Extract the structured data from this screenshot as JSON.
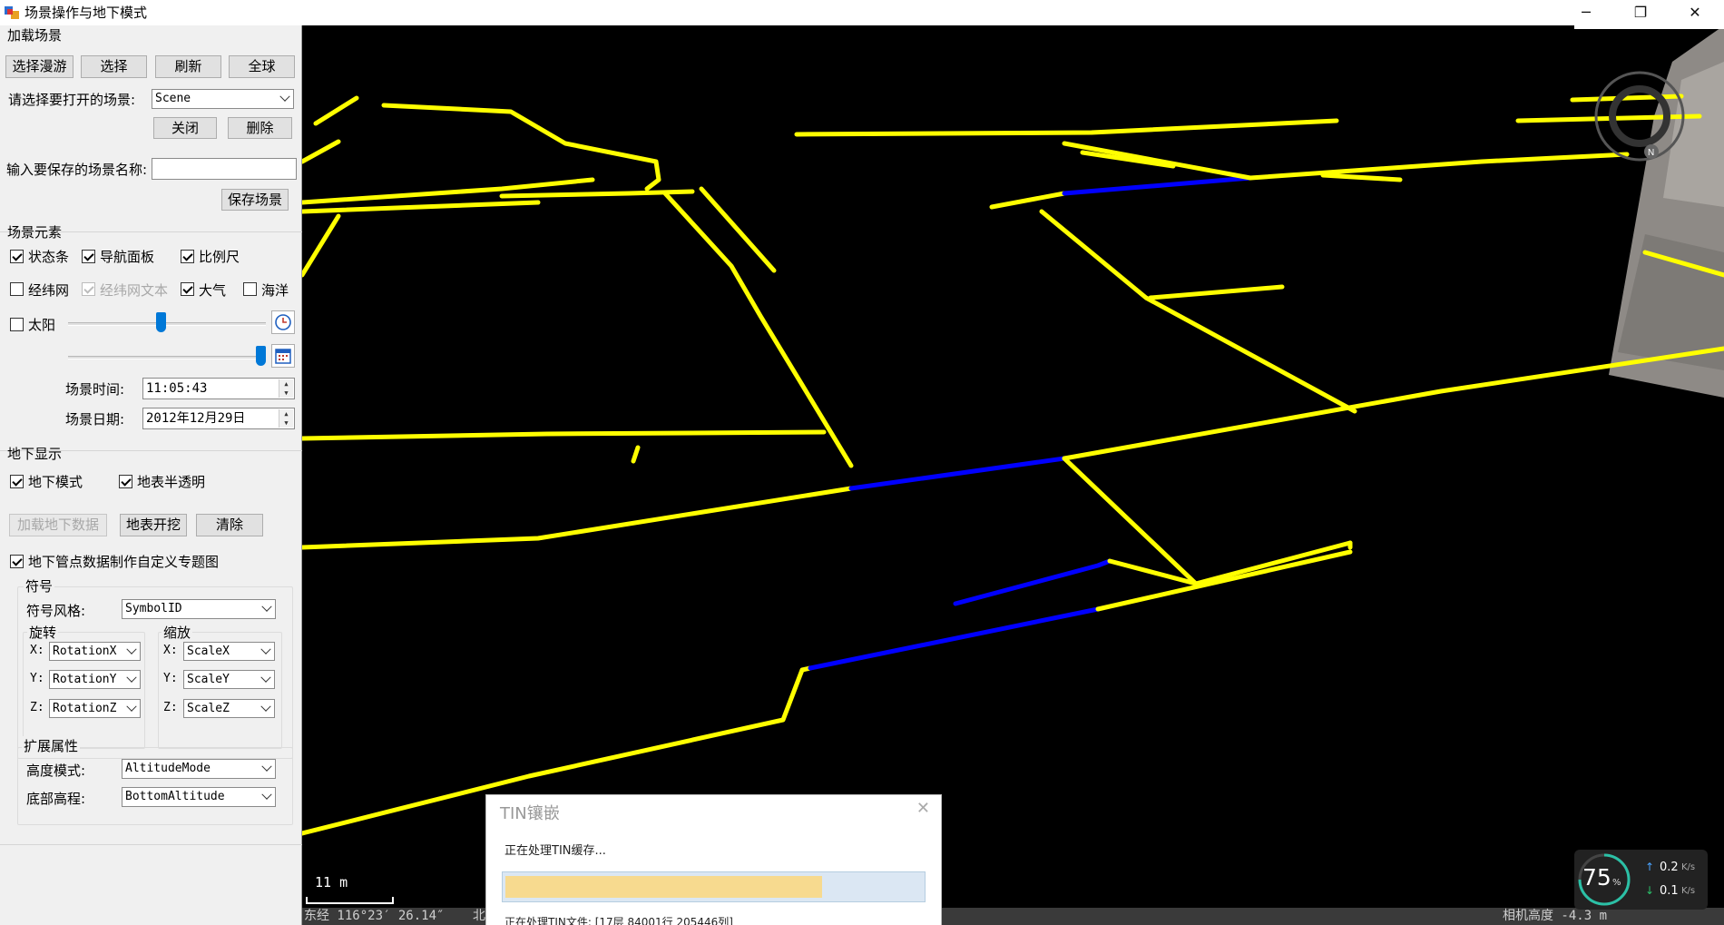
{
  "window": {
    "title": "场景操作与地下模式",
    "minimize_glyph": "─",
    "restore_glyph": "❐",
    "close_glyph": "✕"
  },
  "load_scene": {
    "group_label": "加载场景",
    "buttons": [
      "选择漫游",
      "选择",
      "刷新",
      "全球"
    ],
    "select_label": "请选择要打开的场景:",
    "scene_value": "Scene",
    "close_button": "关闭",
    "delete_button": "删除",
    "save_name_label": "输入要保存的场景名称:",
    "save_name_value": "",
    "save_button": "保存场景"
  },
  "scene_elements": {
    "group_label": "场景元素",
    "statusbar": {
      "label": "状态条",
      "checked": true
    },
    "navpanel": {
      "label": "导航面板",
      "checked": true
    },
    "scalebar": {
      "label": "比例尺",
      "checked": true
    },
    "graticule": {
      "label": "经纬网",
      "checked": false
    },
    "graticule_text": {
      "label": "经纬网文本",
      "checked": true,
      "enabled": false
    },
    "atmosphere": {
      "label": "大气",
      "checked": true
    },
    "ocean": {
      "label": "海洋",
      "checked": false
    },
    "sun": {
      "label": "太阳",
      "checked": false
    },
    "sun_slider_fraction": 0.47,
    "date_slider_fraction": 1.0,
    "time_label": "场景时间:",
    "time_value": "11:05:43",
    "date_label": "场景日期:",
    "date_value": "2012年12月29日",
    "clock_icon": "clock-icon",
    "calendar_icon": "calendar-icon"
  },
  "underground": {
    "group_label": "地下显示",
    "mode": {
      "label": "地下模式",
      "checked": true
    },
    "translucent": {
      "label": "地表半透明",
      "checked": true
    },
    "load_button": "加载地下数据",
    "excavate_button": "地表开挖",
    "clear_button": "清除",
    "custom_theme": {
      "label": "地下管点数据制作自定义专题图",
      "checked": true
    }
  },
  "symbol": {
    "group_label": "符号",
    "style_label": "符号风格:",
    "style_value": "SymbolID",
    "rotation_label": "旋转",
    "scale_label": "缩放",
    "rot_x_label": "X:",
    "rot_x_value": "RotationX",
    "rot_y_label": "Y:",
    "rot_y_value": "RotationY",
    "rot_z_label": "Z:",
    "rot_z_value": "RotationZ",
    "scale_x_label": "X:",
    "scale_x_value": "ScaleX",
    "scale_y_label": "Y:",
    "scale_y_value": "ScaleY",
    "scale_z_label": "Z:",
    "scale_z_value": "ScaleZ"
  },
  "extended": {
    "group_label": "扩展属性",
    "altitude_mode_label": "高度模式:",
    "altitude_mode_value": "AltitudeMode",
    "bottom_alt_label": "底部高程:",
    "bottom_alt_value": "BottomAltitude"
  },
  "viewport": {
    "scale_text": "11 m",
    "status_left": "东经 116°23′ 26.14″",
    "status_left_north": "北",
    "status_right": "相机高度 -4.3 m",
    "compass_letter": "N",
    "colors": {
      "pipe": "#ffff00",
      "selected_pipe": "#0000ff"
    }
  },
  "dialog": {
    "title": "TIN镶嵌",
    "close_glyph": "✕",
    "message": "正在处理TIN缓存...",
    "progress_fraction": 0.76,
    "sub_message": "正在处理TIN文件: [17层 84001行 205446列]"
  },
  "speed_widget": {
    "percent": "75",
    "percent_unit": "%",
    "up": "0.2",
    "up_unit": "K/s",
    "down": "0.1",
    "down_unit": "K/s"
  }
}
